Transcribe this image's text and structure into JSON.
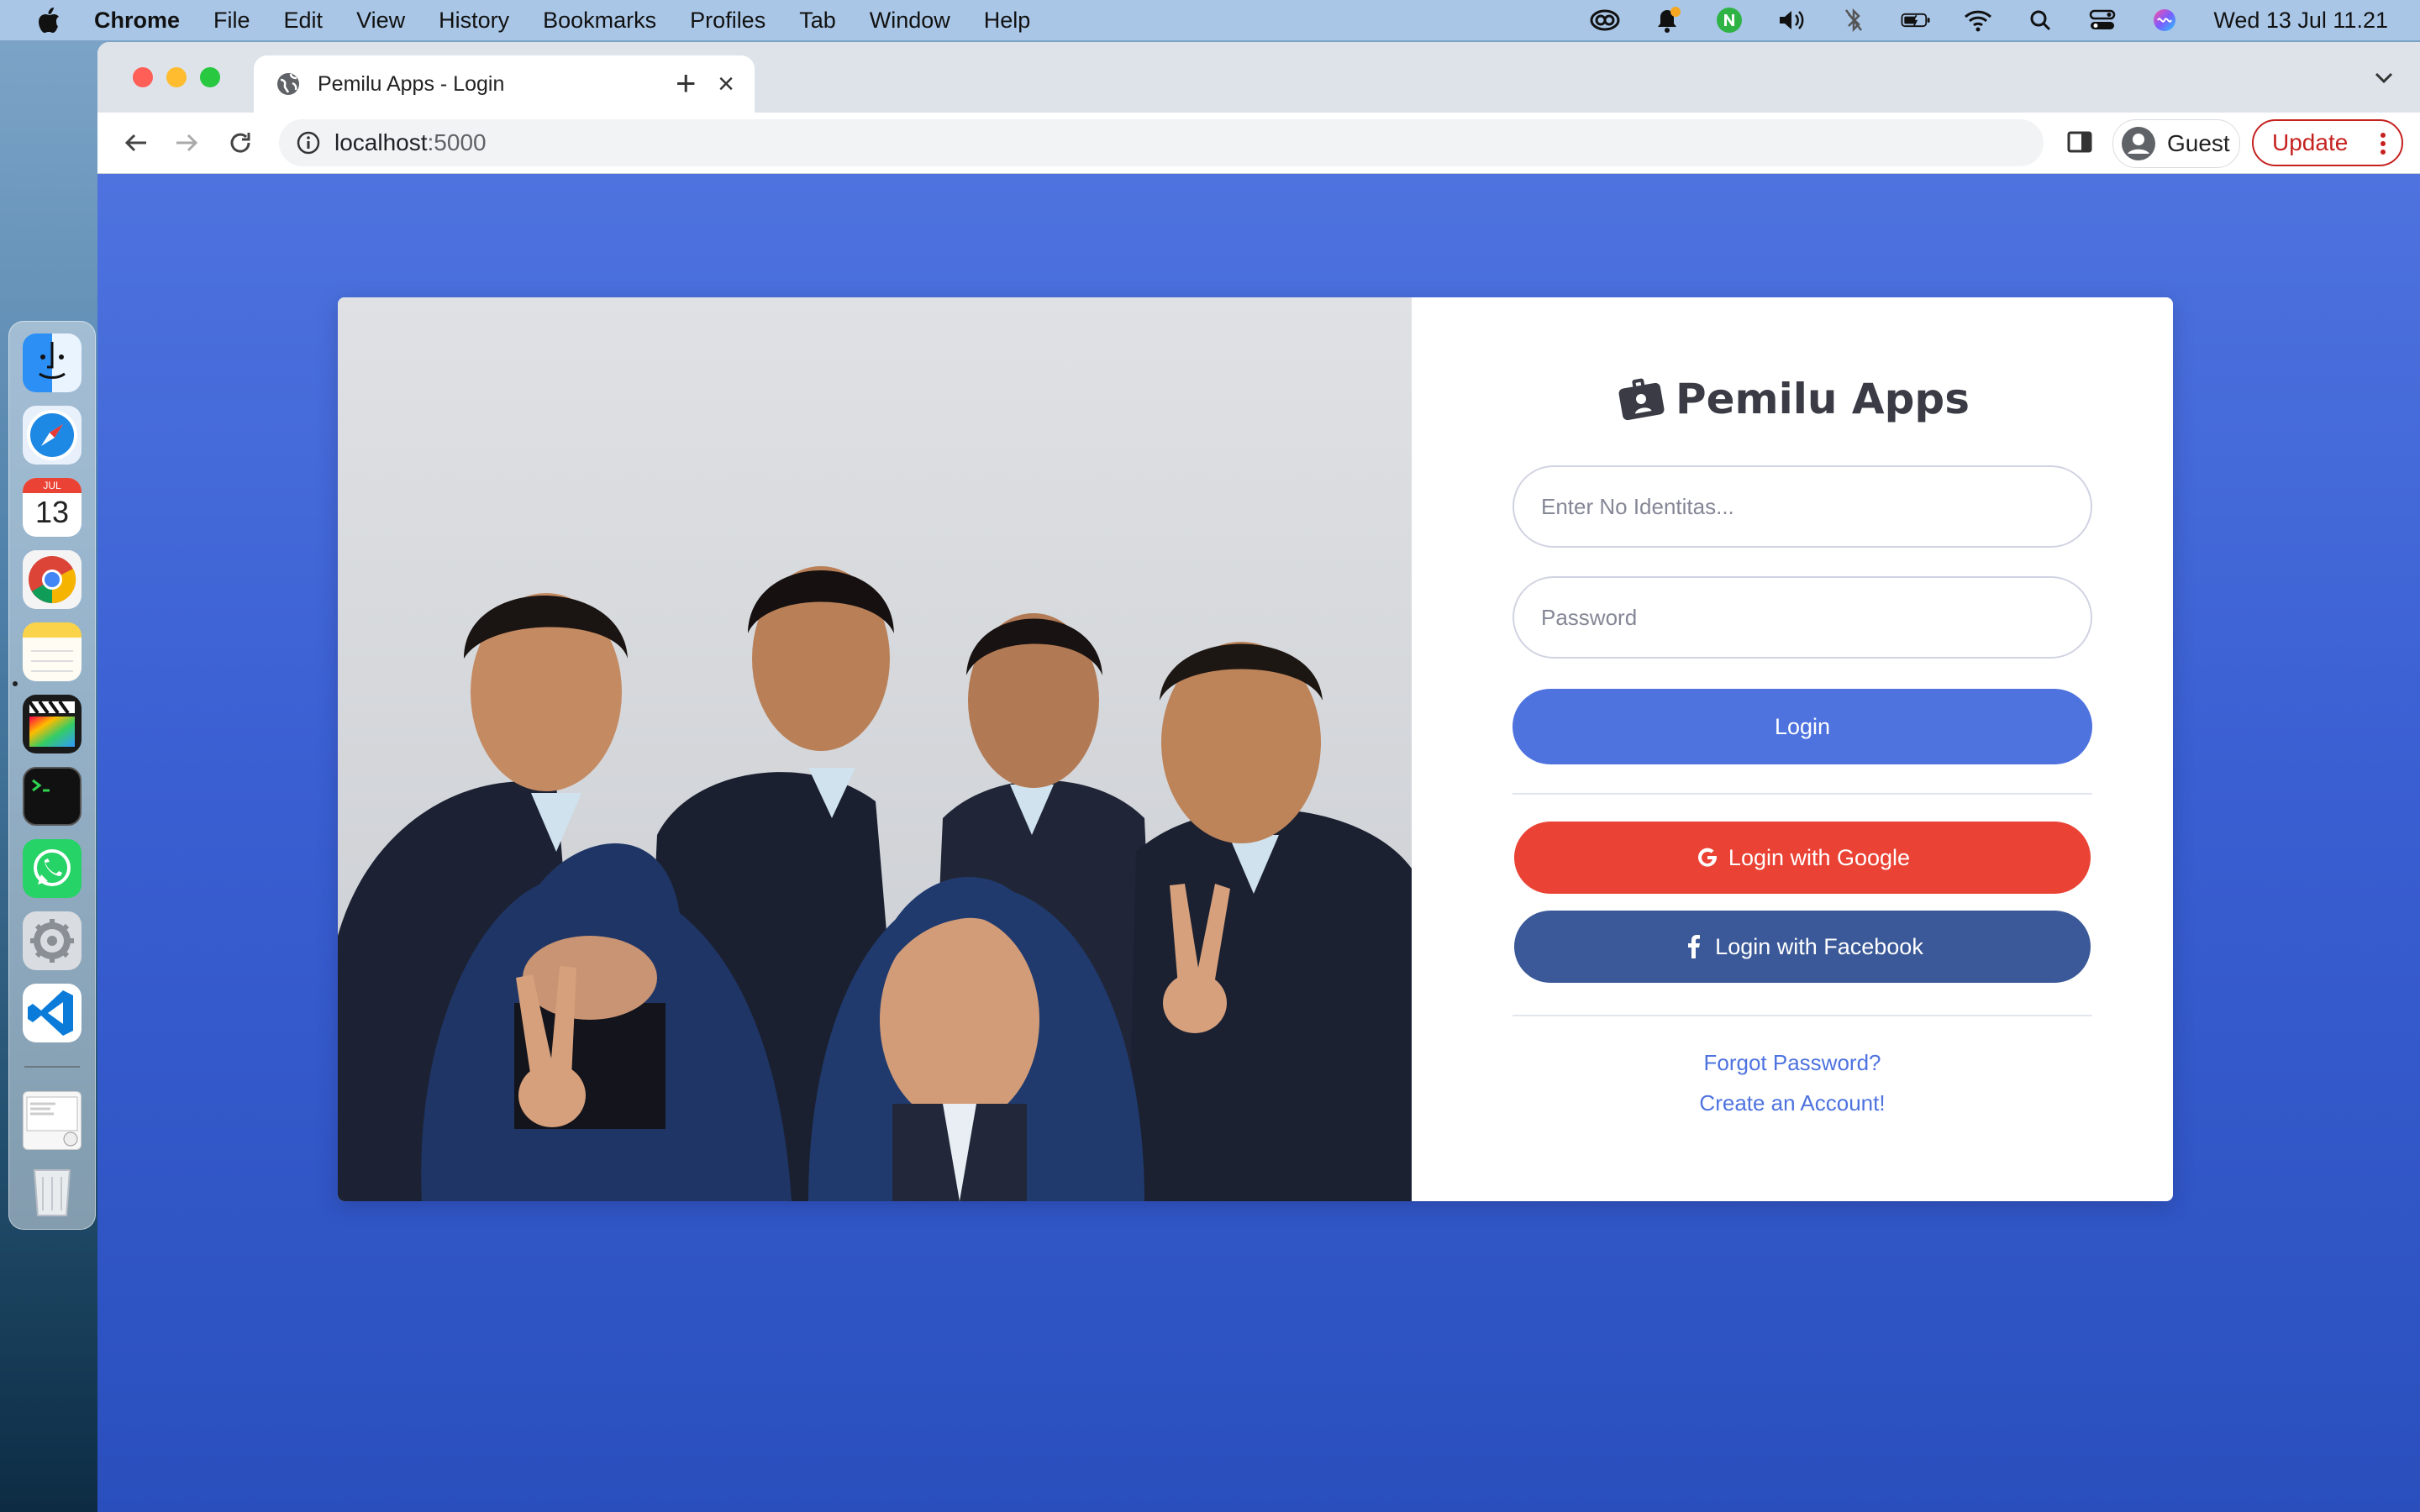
{
  "menubar": {
    "app_name": "Chrome",
    "items": [
      "File",
      "Edit",
      "View",
      "History",
      "Bookmarks",
      "Profiles",
      "Tab",
      "Window",
      "Help"
    ],
    "clock": "Wed 13 Jul  11.21"
  },
  "dock": {
    "apps": [
      "finder",
      "safari",
      "calendar",
      "chrome",
      "notes",
      "final-cut-pro",
      "terminal",
      "whatsapp",
      "system-preferences",
      "vscode",
      "preview-window",
      "trash"
    ],
    "calendar_month": "JUL",
    "calendar_day": "13"
  },
  "browser": {
    "tab_title": "Pemilu Apps - Login",
    "url_host": "localhost",
    "url_port": ":5000",
    "profile_label": "Guest",
    "update_label": "Update"
  },
  "login": {
    "brand_title": "Pemilu Apps",
    "identity_placeholder": "Enter No Identitas...",
    "password_placeholder": "Password",
    "login_button": "Login",
    "google_button": "Login with Google",
    "facebook_button": "Login with Facebook",
    "forgot_link": "Forgot Password?",
    "register_link": "Create an Account!"
  },
  "colors": {
    "primary": "#4e73df",
    "google": "#ea4335",
    "facebook": "#3b5998",
    "update_red": "#c5221f"
  }
}
